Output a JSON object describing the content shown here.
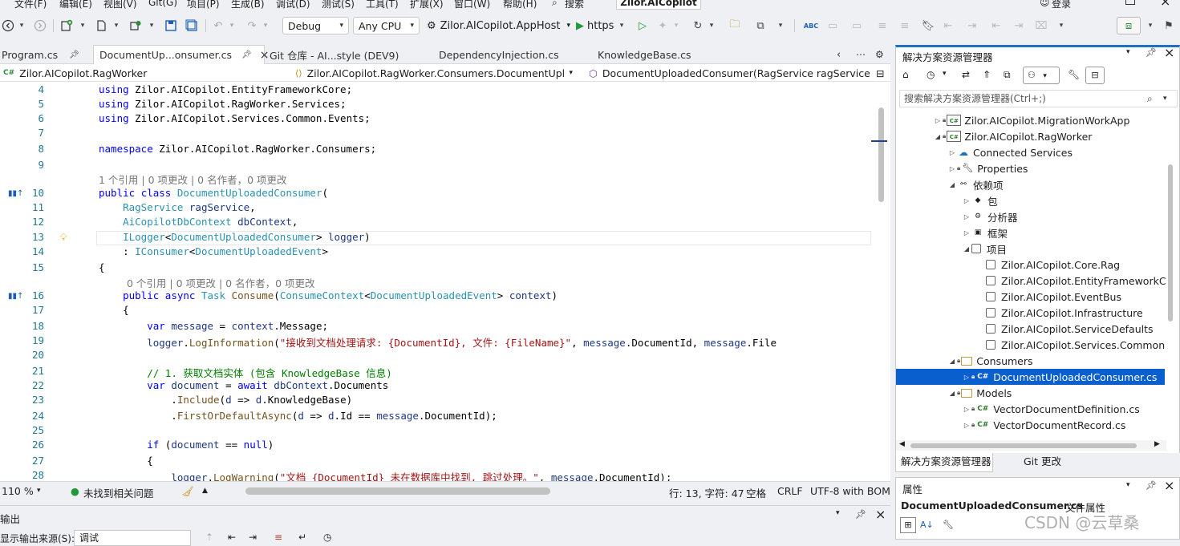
{
  "menu": {
    "items": [
      "文件(F)",
      "编辑(E)",
      "视图(V)",
      "Git(G)",
      "项目(P)",
      "生成(B)",
      "调试(D)",
      "测试(S)",
      "工具(T)",
      "扩展(X)",
      "窗口(W)",
      "帮助(H)"
    ],
    "search": "搜索",
    "app_name": "Zilor.AICopilot",
    "login": "登录"
  },
  "toolbar": {
    "config": "Debug",
    "platform": "Any CPU",
    "startup": "Zilor.AICopilot.AppHost",
    "run_label": "https"
  },
  "tabs": {
    "items": [
      "Program.cs",
      "DocumentUp...onsumer.cs",
      "Git 仓库 - AI...style (DEV9)",
      "DependencyInjection.cs",
      "KnowledgeBase.cs"
    ]
  },
  "navbar": {
    "project": "Zilor.AICopilot.RagWorker",
    "type": "Zilor.AICopilot.RagWorker.Consumers.DocumentUpl",
    "member": "DocumentUploadedConsumer(RagService ragService"
  },
  "editor": {
    "lens_class": "1 个引用 | 0 项更改 | 0 名作者，0 项更改",
    "lens_method": "0 个引用 | 0 项更改 | 0 名作者，0 项更改",
    "lines": [
      {
        "n": "4",
        "t": "using Zilor.AICopilot.EntityFrameworkCore;"
      },
      {
        "n": "5",
        "t": "using Zilor.AICopilot.RagWorker.Services;"
      },
      {
        "n": "6",
        "t": "using Zilor.AICopilot.Services.Common.Events;"
      },
      {
        "n": "7",
        "t": ""
      },
      {
        "n": "8",
        "t": "namespace Zilor.AICopilot.RagWorker.Consumers;"
      },
      {
        "n": "9",
        "t": ""
      },
      {
        "n": "10",
        "t": "public class DocumentUploadedConsumer("
      },
      {
        "n": "11",
        "t": "    RagService ragService,"
      },
      {
        "n": "12",
        "t": "    AiCopilotDbContext dbContext,"
      },
      {
        "n": "13",
        "t": "    ILogger<DocumentUploadedConsumer> logger)"
      },
      {
        "n": "14",
        "t": "    : IConsumer<DocumentUploadedEvent>"
      },
      {
        "n": "15",
        "t": "{"
      },
      {
        "n": "16",
        "t": "    public async Task Consume(ConsumeContext<DocumentUploadedEvent> context)"
      },
      {
        "n": "17",
        "t": "    {"
      },
      {
        "n": "18",
        "t": "        var message = context.Message;"
      },
      {
        "n": "19",
        "t": "        logger.LogInformation(\"接收到文档处理请求: {DocumentId}, 文件: {FileName}\", message.DocumentId, message.File"
      },
      {
        "n": "20",
        "t": ""
      },
      {
        "n": "21",
        "t": "        // 1. 获取文档实体 (包含 KnowledgeBase 信息)"
      },
      {
        "n": "22",
        "t": "        var document = await dbContext.Documents"
      },
      {
        "n": "23",
        "t": "            .Include(d => d.KnowledgeBase)"
      },
      {
        "n": "24",
        "t": "            .FirstOrDefaultAsync(d => d.Id == message.DocumentId);"
      },
      {
        "n": "25",
        "t": ""
      },
      {
        "n": "26",
        "t": "        if (document == null)"
      },
      {
        "n": "27",
        "t": "        {"
      },
      {
        "n": "28",
        "t": "            logger.LogWarning(\"文档 {DocumentId} 未在数据库中找到, 跳过处理。\", message.DocumentId);"
      }
    ]
  },
  "status": {
    "zoom": "110 %",
    "issues": "未找到相关问题",
    "position": "行: 13, 字符: 47",
    "spacing": "空格",
    "line_ending": "CRLF",
    "encoding": "UTF-8 with BOM"
  },
  "output": {
    "title": "输出",
    "source_label": "显示输出来源(S):",
    "source_value": "调试"
  },
  "solution_explorer": {
    "title": "解决方案资源管理器",
    "search_placeholder": "搜索解决方案资源管理器(Ctrl+;)",
    "nodes": [
      {
        "label": "Zilor.AICopilot.MigrationWorkApp",
        "kind": "project",
        "expand": "right",
        "indent": 0
      },
      {
        "label": "Zilor.AICopilot.RagWorker",
        "kind": "project",
        "expand": "down",
        "indent": 0
      },
      {
        "label": "Connected Services",
        "kind": "connected",
        "expand": "right",
        "indent": 1
      },
      {
        "label": "Properties",
        "kind": "properties",
        "expand": "right",
        "indent": 1
      },
      {
        "label": "依赖项",
        "kind": "deps",
        "expand": "down",
        "indent": 1
      },
      {
        "label": "包",
        "kind": "package",
        "expand": "right",
        "indent": 2
      },
      {
        "label": "分析器",
        "kind": "analyzer",
        "expand": "right",
        "indent": 2
      },
      {
        "label": "框架",
        "kind": "framework",
        "expand": "right",
        "indent": 2
      },
      {
        "label": "项目",
        "kind": "file",
        "expand": "down",
        "indent": 2
      },
      {
        "label": "Zilor.AICopilot.Core.Rag",
        "kind": "file",
        "expand": "",
        "indent": 3
      },
      {
        "label": "Zilor.AICopilot.EntityFrameworkC",
        "kind": "file",
        "expand": "",
        "indent": 3
      },
      {
        "label": "Zilor.AICopilot.EventBus",
        "kind": "file",
        "expand": "",
        "indent": 3
      },
      {
        "label": "Zilor.AICopilot.Infrastructure",
        "kind": "file",
        "expand": "",
        "indent": 3
      },
      {
        "label": "Zilor.AICopilot.ServiceDefaults",
        "kind": "file",
        "expand": "",
        "indent": 3
      },
      {
        "label": "Zilor.AICopilot.Services.Common",
        "kind": "file",
        "expand": "",
        "indent": 3
      },
      {
        "label": "Consumers",
        "kind": "folder",
        "expand": "down",
        "indent": 1
      },
      {
        "label": "DocumentUploadedConsumer.cs",
        "kind": "cs",
        "expand": "right",
        "indent": 2,
        "selected": true
      },
      {
        "label": "Models",
        "kind": "folder",
        "expand": "down",
        "indent": 1
      },
      {
        "label": "VectorDocumentDefinition.cs",
        "kind": "cs",
        "expand": "right",
        "indent": 2
      },
      {
        "label": "VectorDocumentRecord.cs",
        "kind": "cs",
        "expand": "right",
        "indent": 2
      }
    ],
    "tab_active": "解决方案资源管理器",
    "tab_git": "Git 更改"
  },
  "properties": {
    "title": "属性",
    "object": "DocumentUploadedConsumer.cs",
    "object_kind": "文件属性",
    "watermark": "CSDN @云草桑"
  }
}
